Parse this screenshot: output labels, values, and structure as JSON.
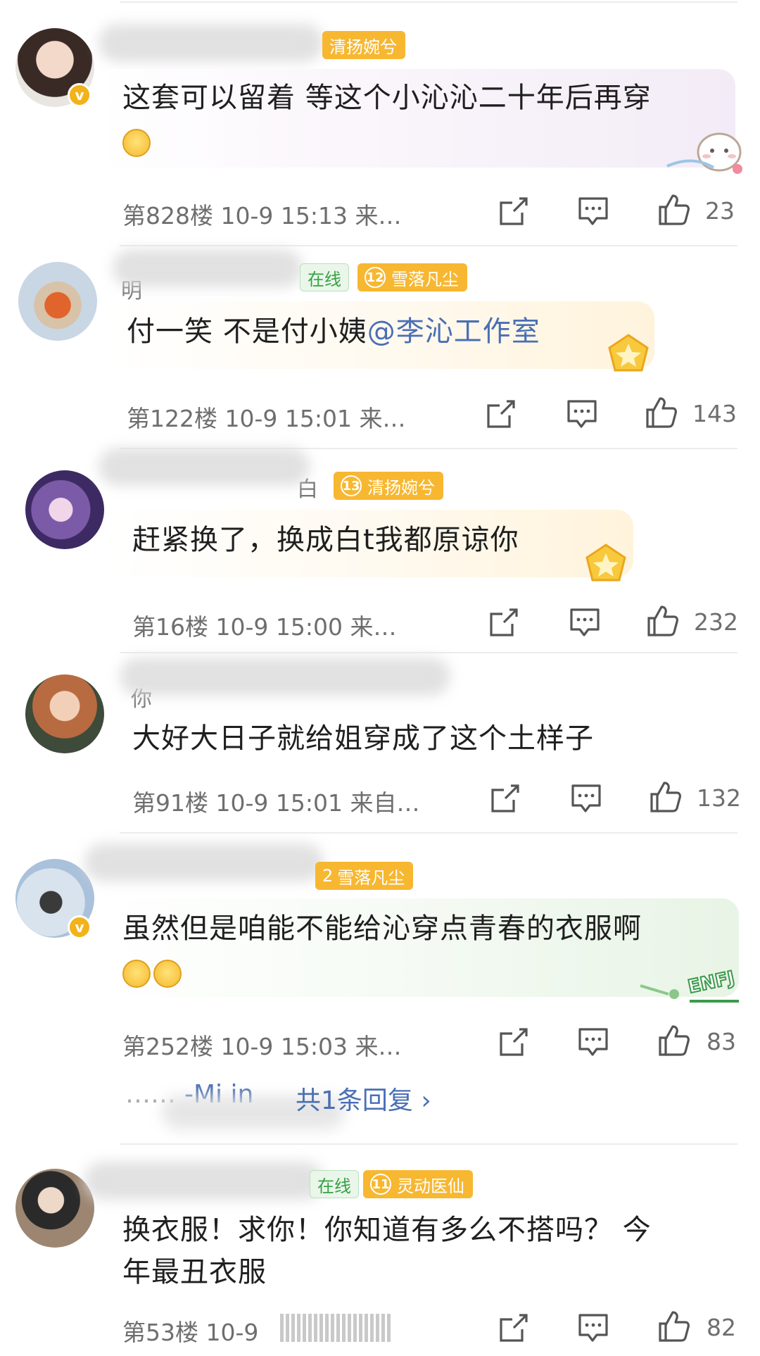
{
  "comments": [
    {
      "id": "c1",
      "name_peek": "",
      "tags": [
        {
          "level": "",
          "label": "清扬婉兮"
        }
      ],
      "online": "",
      "text": "这套可以留着 等这个小沁沁二十年后再穿",
      "floor": "第828楼",
      "time": "10-9 15:13",
      "source": "来…",
      "likes": "23"
    },
    {
      "id": "c2",
      "name_peek": "明",
      "tags": [
        {
          "level": "12",
          "label": "雪落凡尘"
        }
      ],
      "online": "在线",
      "text_plain": "付一笑 不是付小姨",
      "text_mention": "@李沁工作室",
      "floor": "第122楼",
      "time": "10-9 15:01",
      "source": "来…",
      "likes": "143"
    },
    {
      "id": "c3",
      "name_peek": "白",
      "tags": [
        {
          "level": "13",
          "label": "清扬婉兮"
        }
      ],
      "online": "",
      "text": "赶紧换了，换成白t我都原谅你",
      "floor": "第16楼",
      "time": "10-9 15:00",
      "source": "来…",
      "likes": "232"
    },
    {
      "id": "c4",
      "name_peek": "你",
      "tags": [],
      "online": "",
      "text": "大好大日子就给姐穿成了这个土样子",
      "floor": "第91楼",
      "time": "10-9 15:01",
      "source": "来自…",
      "likes": "132"
    },
    {
      "id": "c5",
      "name_peek": "",
      "tags": [
        {
          "level": "2",
          "label": "雪落凡尘"
        }
      ],
      "online": "",
      "text": "虽然但是咱能不能给沁穿点青春的衣服啊",
      "floor": "第252楼",
      "time": "10-9 15:03",
      "source": "来…",
      "likes": "83",
      "reply_prefix": "……",
      "reply_name_peek": "-Mi in",
      "reply_summary": "共1条回复 ›"
    },
    {
      "id": "c6",
      "name_peek": "",
      "tags": [
        {
          "level": "11",
          "label": "灵动医仙"
        }
      ],
      "online": "在线",
      "text_line1": "换衣服！求你！你知道有多么不搭吗？ 今",
      "text_line2": "年最丑衣服",
      "floor": "第53楼",
      "time": "10-9",
      "source": "",
      "likes": "82"
    }
  ],
  "colors": {
    "tag_bg": "#f7b731",
    "mention": "#4a6fb5",
    "meta_text": "#6e6e6e",
    "online_text": "#35a244"
  },
  "icons": [
    "share-icon",
    "comment-icon",
    "like-icon",
    "verified-icon"
  ]
}
